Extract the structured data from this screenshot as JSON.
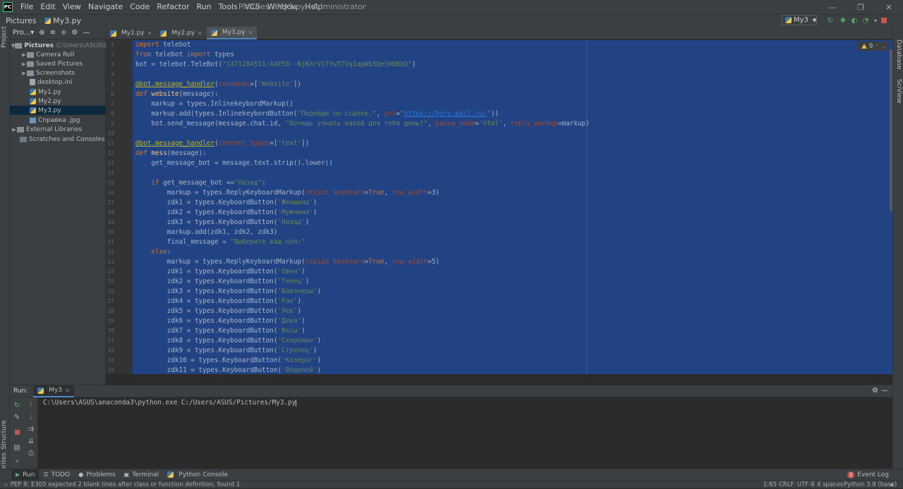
{
  "menubar": {
    "items": [
      "File",
      "Edit",
      "View",
      "Navigate",
      "Code",
      "Refactor",
      "Run",
      "Tools",
      "VCS",
      "Window",
      "Help"
    ],
    "window_title": "Pictures - My3.py - Administrator",
    "logo_text": "PC"
  },
  "navbar": {
    "crumbs": [
      "Pictures",
      "My3.py"
    ],
    "run_config": "My3"
  },
  "left_strip": {
    "project_label": "Project",
    "structure_label": "Structure",
    "favorites_label": "Favorites"
  },
  "right_strip": {
    "database_label": "Database",
    "sciview_label": "SciView"
  },
  "project": {
    "header_label": "Pro...▾",
    "tree": [
      {
        "label": "Pictures",
        "path": "C:\\Users\\ASUS\\Pictu",
        "kind": "folder",
        "expanded": true,
        "depth": 0
      },
      {
        "label": "Camera Roll",
        "kind": "folder",
        "depth": 1
      },
      {
        "label": "Saved Pictures",
        "kind": "folder",
        "depth": 1
      },
      {
        "label": "Screenshots",
        "kind": "folder",
        "depth": 1
      },
      {
        "label": "desktop.ini",
        "kind": "file",
        "depth": 1
      },
      {
        "label": "My1.py",
        "kind": "py",
        "depth": 1
      },
      {
        "label": "My2.py",
        "kind": "py",
        "depth": 1
      },
      {
        "label": "My3.py",
        "kind": "py",
        "depth": 1,
        "selected": true
      },
      {
        "label": "Справка .jpg",
        "kind": "img",
        "depth": 1
      },
      {
        "label": "External Libraries",
        "kind": "lib",
        "depth": 0
      },
      {
        "label": "Scratches and Consoles",
        "kind": "lib",
        "depth": 0
      }
    ]
  },
  "tabs": [
    {
      "label": "My1.py",
      "active": false
    },
    {
      "label": "My2.py",
      "active": false
    },
    {
      "label": "My3.py",
      "active": true
    }
  ],
  "editor": {
    "warning_count": "9",
    "lines": [
      "import telebot",
      "from telebot import types",
      "bot = telebot.TeleBot(\"1471284551:AAE58--NjBXrV1fYwT7VqIapWb5QeSHOBXQ\")",
      "",
      "@bot.message_handler(commands=['Website'])",
      "def website(message):",
      "    markup = types.InlinekeybordMarkup()",
      "    markup.add(types.InlinekeybordButton(\"Перейди по ссылке,\", url=\"https://horo.mail.ru/\"))",
      "    bot.send_message(message.chat.id, \"Хочешь узнать какой для тебя день!\", parse_mode='html', reply_markup=markup)",
      "",
      "@bot.message_handler(content_types=['text'])",
      "def mess(message):",
      "    get_message_bot = message.text.strip().lower()",
      "",
      "    if get_message_bot ==\"Назад\":",
      "        markup = types.ReplyKeyboardMarkup(resize_keyboard=True, row_width=3)",
      "        zdk1 = types.KeyboardButton('Женщина')",
      "        zdk2 = types.KeyboardButton('Мужчина')",
      "        zdk3 = types.KeyboardButton('Назад')",
      "        markup.add(zdk1, zdk2, zdk3)",
      "        final_message = \"Выберите ваш пол:\"",
      "    else:",
      "        markup = types.ReplyKeyboardMarkup(resize_keyboard=True, row_width=5)",
      "        zdk1 = types.KeyboardButton('Овен')",
      "        zdk2 = types.KeyboardButton('Телец')",
      "        zdk3 = types.KeyboardButton('Близнецы')",
      "        zdk4 = types.KeyboardButton('Рак')",
      "        zdk5 = types.KeyboardButton('Лев')",
      "        zdk6 = types.KeyboardButton('Дева')",
      "        zdk7 = types.KeyboardButton('Весы')",
      "        zdk8 = types.KeyboardButton('Скорпион')",
      "        zdk9 = types.KeyboardButton('Стрелец')",
      "        zdk10 = types.KeyboardButton('Козерог')",
      "        zdk11 = types.KeyboardButton('Водолей')"
    ]
  },
  "run": {
    "label": "Run:",
    "tab": "My3",
    "command": "C:\\Users\\ASUS\\anaconda3\\python.exe C:/Users/ASUS/Pictures/My3.py"
  },
  "bottom_tabs": [
    "Run",
    "TODO",
    "Problems",
    "Terminal",
    "Python Console"
  ],
  "event_log": {
    "label": "Event Log",
    "count": "2"
  },
  "status": {
    "message": "PEP 8: E305 expected 2 blank lines after class or function definition, found 1",
    "position": "1:65",
    "line_sep": "CRLF",
    "encoding": "UTF-8",
    "indent": "4 spaces",
    "interpreter": "Python 3.8 (base)"
  },
  "colors": {
    "accent": "#4a88c7",
    "selection": "#214283",
    "bg": "#2b2b2b",
    "panel": "#3c3f41"
  }
}
